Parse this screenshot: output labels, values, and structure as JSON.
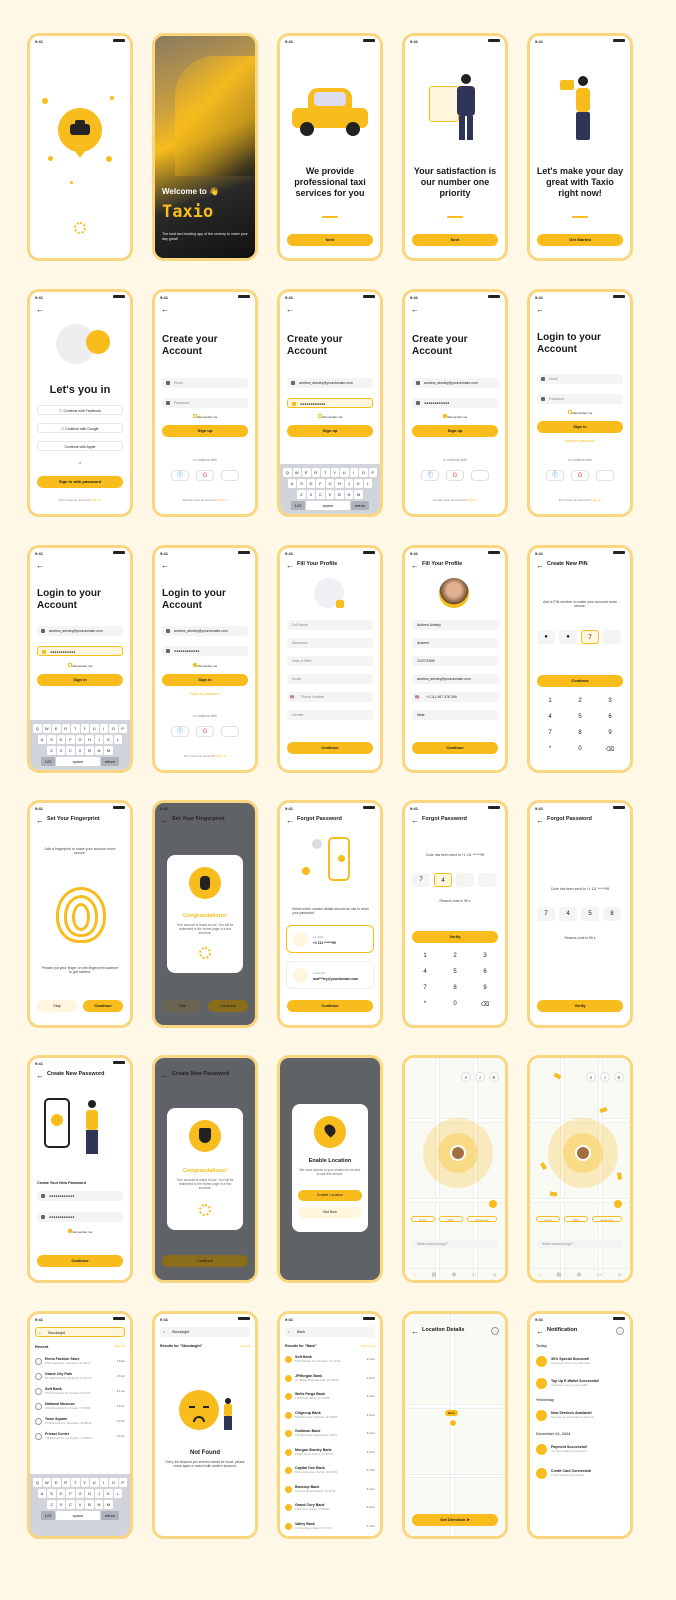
{
  "status_time": "9:41",
  "colors": {
    "accent": "#F8BC1C",
    "light": "#FFF6DD",
    "bg": "#FFF8E6",
    "border": "#FBD680"
  },
  "onboard": {
    "welcome_title": "Welcome to 👋",
    "brand": "Taxio",
    "welcome_sub": "The best taxi booking app of the century to make your day great!",
    "slide1": "We provide professional taxi services for you",
    "slide2": "Your satisfaction is our number one priority",
    "slide3": "Let's make your day great with Taxio right now!",
    "next": "Next",
    "get_started": "Get Started"
  },
  "auth": {
    "lets_you_in": "Let's you in",
    "continue_facebook": "Continue with Facebook",
    "continue_google": "Continue with Google",
    "continue_apple": "Continue with Apple",
    "or": "or",
    "sign_in_password": "Sign in with password",
    "no_account": "Don't have an account?",
    "sign_up_link": "Sign up",
    "create_account": "Create your Account",
    "login_account": "Login to your Account",
    "email_ph": "Email",
    "password_ph": "Password",
    "email_val": "andrew_ainsley@yourdomain.com",
    "password_val": "●●●●●●●●●●●●",
    "remember": "Remember me",
    "sign_up": "Sign up",
    "sign_in": "Sign in",
    "or_continue": "or continue with",
    "have_account": "Already have an account?",
    "sign_in_link": "Sign in",
    "forgot": "Forgot the password?"
  },
  "keyboard": {
    "row1": [
      "Q",
      "W",
      "E",
      "R",
      "T",
      "Y",
      "U",
      "I",
      "O",
      "P"
    ],
    "row2": [
      "A",
      "S",
      "D",
      "F",
      "G",
      "H",
      "J",
      "K",
      "L"
    ],
    "row3": [
      "Z",
      "X",
      "C",
      "V",
      "B",
      "N",
      "M"
    ],
    "mode": "123",
    "space": "space",
    "ret": "return"
  },
  "profile": {
    "title": "Fill Your Profile",
    "full_name_ph": "Full Name",
    "nickname_ph": "Nickname",
    "dob_ph": "Date of Birth",
    "email_ph": "Email",
    "phone_ph": "Phone Number",
    "gender_ph": "Gender",
    "full_name": "Andrew Ainsley",
    "nickname": "Andrew",
    "dob": "12/27/1995",
    "email": "andrew_ainsley@yourdomain.com",
    "phone": "+1 111 467 378 399",
    "gender": "Male",
    "continue": "Continue"
  },
  "pin": {
    "title": "Create New PIN",
    "sub": "Add a PIN number to make your account more secure.",
    "digit": "7",
    "keys": [
      "1",
      "2",
      "3",
      "4",
      "5",
      "6",
      "7",
      "8",
      "9",
      "*",
      "0",
      "⌫"
    ]
  },
  "fingerprint": {
    "title": "Set Your Fingerprint",
    "sub": "Add a fingerprint to make your account more secure.",
    "hint": "Please put your finger on the fingerprint scanner to get started.",
    "skip": "Skip",
    "continue": "Continue",
    "congrats": "Congratulations!",
    "ready": "Your account is ready to use. You will be redirected to the Home page in a few seconds.",
    "sign_in_link": "Sign in with password"
  },
  "forgot": {
    "title": "Forgot Password",
    "sub": "Select which contact details should we use to reset your password",
    "via_sms": "via SMS:",
    "sms_val": "+1 111 ******99",
    "via_email": "via Email:",
    "email_val": "and***ley@yourdomain.com",
    "continue": "Continue",
    "code_sent": "Code has been send to +1 111 ******99",
    "resend": "Resend code in 55 s",
    "otp1": [
      "7",
      "4",
      "",
      ""
    ],
    "otp2": [
      "7",
      "4",
      "5",
      "8"
    ],
    "verify": "Verify"
  },
  "newpass": {
    "title": "Create New Password",
    "label": "Create Your New Password",
    "pass": "●●●●●●●●●●●●",
    "remember": "Remember me",
    "continue": "Continue",
    "congrats": "Congratulations!",
    "ready": "Your account is ready to use. You will be redirected to the Home page in a few seconds."
  },
  "location": {
    "enable": "Enable Location",
    "desc": "We need access to your location to be able to use this service.",
    "enable_btn": "Enable Location",
    "not_now": "Not Now",
    "chips": [
      "Home",
      "Office",
      "Apartment"
    ],
    "where": "Where would you go?",
    "nav": [
      "Home",
      "Bookings",
      "Promos",
      "Wallet",
      "Profile"
    ],
    "details_title": "Location Details",
    "pin_label": "Bank",
    "get_direction": "Get Direction"
  },
  "search": {
    "query": "Stuudarght",
    "recent": "Recent",
    "clear_all": "Clear All",
    "recent_items": [
      {
        "name": "Elena Fashion Store",
        "addr": "8705 Augusta St. Cleveland, OH 44107",
        "dist": "1.8 km"
      },
      {
        "name": "Grand City Park",
        "addr": "83 Caldwell Street Longwood, FL 32779",
        "dist": "2.6 km"
      },
      {
        "name": "Soft Bank",
        "addr": "7521 Richardson St. Newark, NJ 07103",
        "dist": "3.1 km"
      },
      {
        "name": "National Museum",
        "addr": "9123 Wentworth St. Norwalk, CT 06851",
        "dist": "3.5 km"
      },
      {
        "name": "Town Square",
        "addr": "17 Roosevelt Ave. Wyandotte, MI 48192",
        "dist": "4.0 km"
      },
      {
        "name": "Privasi Center",
        "addr": "746 Elmhurst St. Los Angeles, CA 90057",
        "dist": "4.4 km"
      }
    ],
    "results_for": "Results for \"Stuudarght\"",
    "zero": "0 found",
    "not_found": "Not Found",
    "not_found_desc": "Sorry, the keyword you entered cannot be found, please check again or search with another keyword.",
    "bank_query": "Bank",
    "bank_results": "Results for \"Bank\"",
    "bank_count": "1,247 found",
    "banks": [
      {
        "name": "Soft Bank",
        "addr": "6301 Wheeler Ave. Brooklyn, NY 11233",
        "dist": "2.4 km"
      },
      {
        "name": "JPMorgan Bank",
        "addr": "34 Hilldale Road Salt Lake, UT 84118",
        "dist": "2.8 km"
      },
      {
        "name": "Wells Fargo Bank",
        "addr": "7 Bell Drive, Bronx, NY 10468",
        "dist": "3.2 km"
      },
      {
        "name": "Citigroup Bank",
        "addr": "55 Baker Road, Charlotte, NC 28205",
        "dist": "3.6 km"
      },
      {
        "name": "Goldman Bank",
        "addr": "9 Bridge Street Lakewood, NJ 08701",
        "dist": "4.2 km"
      },
      {
        "name": "Morgan Stanley Bank",
        "addr": "21 Elm Street, Fresno, CA 93722",
        "dist": "4.8 km"
      },
      {
        "name": "Capital One Bank",
        "addr": "80 Lexington Ave. Norfolk, VA 23503",
        "dist": "5.1 km"
      },
      {
        "name": "Bancorp Bank",
        "addr": "14 Grove Road Madison, WI 53711",
        "dist": "5.4 km"
      },
      {
        "name": "Grand Cory Bank",
        "addr": "8 Mill Lane, Ogden, UT 84401",
        "dist": "5.9 km"
      },
      {
        "name": "Valley Bank",
        "addr": "31 Pine Street, Waco, TX 76710",
        "dist": "6.3 km"
      }
    ]
  },
  "notif": {
    "title": "Notification",
    "today": "Today",
    "yesterday": "Yesterday",
    "date": "December 22, 2024",
    "items": [
      {
        "t": "30% Special Discount!",
        "s": "Special promotion only valid today"
      },
      {
        "t": "Top Up E-Wallet Successful!",
        "s": "You have to top up your e-wallet"
      },
      {
        "t": "New Services Available!",
        "s": "Now you can track orders in real time"
      },
      {
        "t": "Payment Successful!",
        "s": "You have made a taxi payment"
      },
      {
        "t": "Credit Card Connected!",
        "s": "Credit Card has been linked!"
      }
    ]
  }
}
